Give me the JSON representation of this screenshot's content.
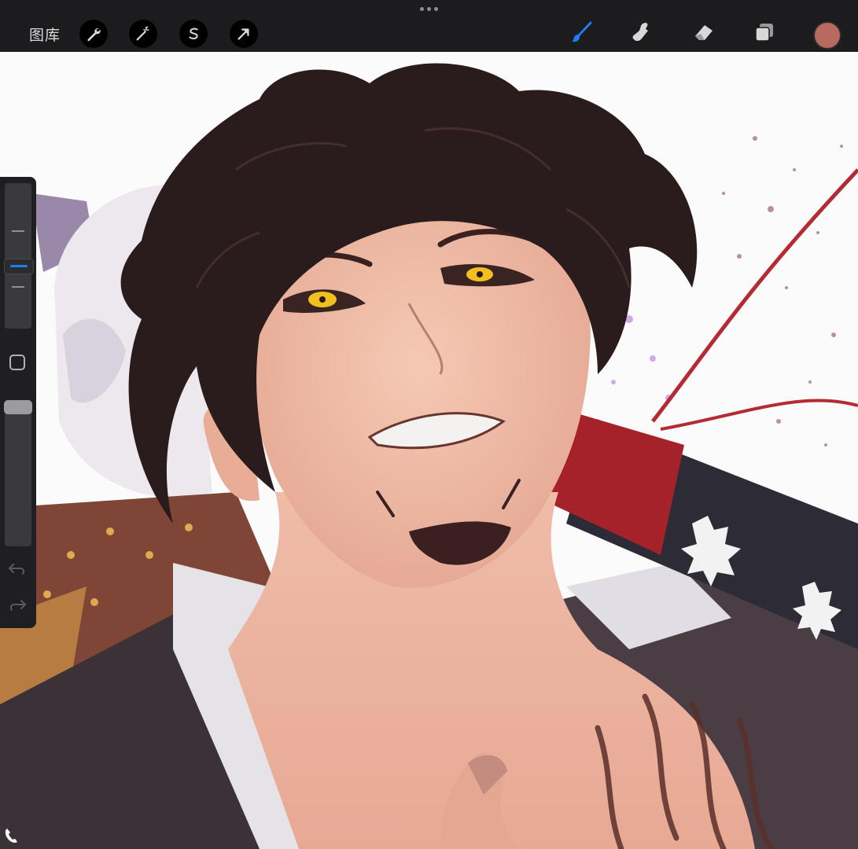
{
  "app": {
    "gallery_label": "图库",
    "colors": {
      "toolbar_bg": "#1c1c1e",
      "active_tool": "#1f7cf2",
      "current_color": "#b86a60",
      "sidebar_bg": "#1f1f21"
    }
  },
  "toolbar": {
    "left_tools": [
      {
        "name": "actions",
        "icon": "wrench-icon"
      },
      {
        "name": "adjustments",
        "icon": "magic-wand-icon"
      },
      {
        "name": "selection",
        "icon": "selection-s-icon"
      },
      {
        "name": "transform",
        "icon": "arrow-cursor-icon"
      }
    ],
    "right_tools": [
      {
        "name": "brush",
        "icon": "brush-icon",
        "active": true
      },
      {
        "name": "smudge",
        "icon": "smudge-finger-icon",
        "active": false
      },
      {
        "name": "eraser",
        "icon": "eraser-icon",
        "active": false
      },
      {
        "name": "layers",
        "icon": "layers-icon",
        "active": false
      }
    ]
  },
  "sidebar": {
    "brush_size_level": 0.55,
    "opacity_level": 0.0,
    "undo_icon": "undo-icon",
    "redo_icon": "redo-icon",
    "modify_icon": "square-modify-icon"
  },
  "canvas": {
    "artwork": "illustration-canvas"
  }
}
